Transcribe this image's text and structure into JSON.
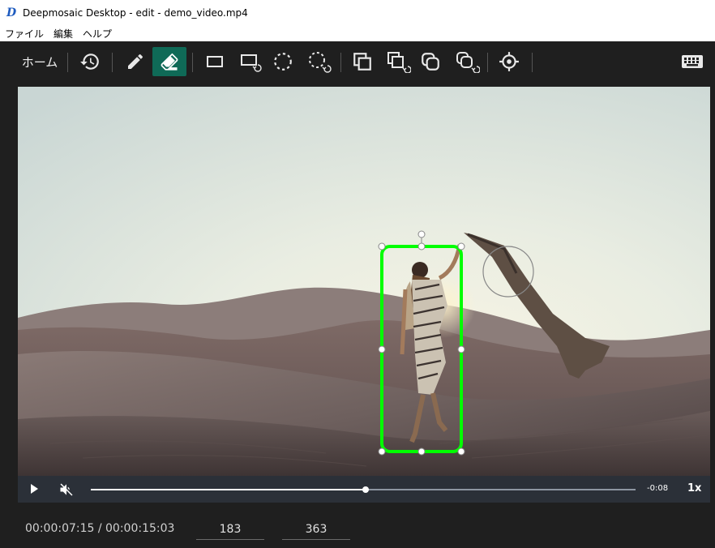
{
  "window": {
    "title": "Deepmosaic Desktop - edit - demo_video.mp4",
    "app_icon_glyph": "D"
  },
  "menu": [
    "ファイル",
    "編集",
    "ヘルプ"
  ],
  "toolbar": {
    "home_label": "ホーム",
    "tools": [
      {
        "name": "history-icon",
        "active": false
      },
      {
        "name": "pencil-icon",
        "active": false
      },
      {
        "name": "eraser-icon",
        "active": true
      },
      {
        "name": "rectangle-icon",
        "active": false
      },
      {
        "name": "rectangle-track-icon",
        "active": false
      },
      {
        "name": "ellipse-icon",
        "active": false
      },
      {
        "name": "ellipse-track-icon",
        "active": false
      },
      {
        "name": "copy-rect-icon",
        "active": false
      },
      {
        "name": "copy-rect-track-icon",
        "active": false
      },
      {
        "name": "copy-ellipse-icon",
        "active": false
      },
      {
        "name": "copy-ellipse-track-icon",
        "active": false
      },
      {
        "name": "target-icon",
        "active": false
      },
      {
        "name": "keyboard-icon",
        "active": false
      }
    ],
    "accent_color": "#0f6a57"
  },
  "video": {
    "selection_color": "#00ff00"
  },
  "player": {
    "progress": 0.505,
    "remaining": "-0:08",
    "speed": "1x",
    "muted": true
  },
  "footer": {
    "timecode": "00:00:07:15 / 00:00:15:03",
    "field_a": "183",
    "field_b": "363"
  }
}
